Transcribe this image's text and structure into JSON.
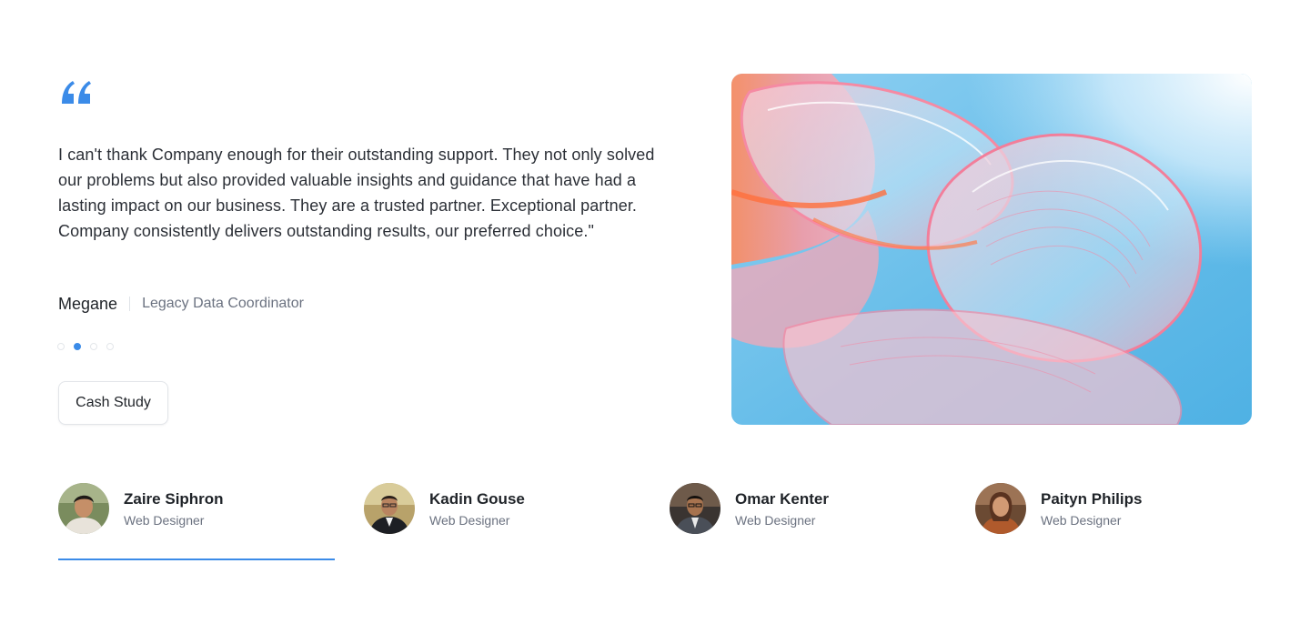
{
  "testimonial": {
    "quote_icon": "quote-icon",
    "text": "I can't thank Company enough for their outstanding support. They not only solved our problems but also provided valuable insights and guidance that have had a lasting impact on our business. They are a trusted partner. Exceptional partner. Company consistently delivers outstanding results, our preferred choice.\"",
    "author_name": "Megane",
    "author_role": "Legacy Data Coordinator",
    "slides_total": 4,
    "active_slide": 2,
    "button_label": "Cash Study",
    "accent_color": "#3b8be8"
  },
  "hero": {
    "image": "abstract-glass-ribbon-artwork"
  },
  "people": [
    {
      "name": "Zaire Siphron",
      "role": "Web Designer",
      "selected": true
    },
    {
      "name": "Kadin Gouse",
      "role": "Web Designer",
      "selected": false
    },
    {
      "name": "Omar Kenter",
      "role": "Web Designer",
      "selected": false
    },
    {
      "name": "Paityn Philips",
      "role": "Web Designer",
      "selected": false
    }
  ]
}
